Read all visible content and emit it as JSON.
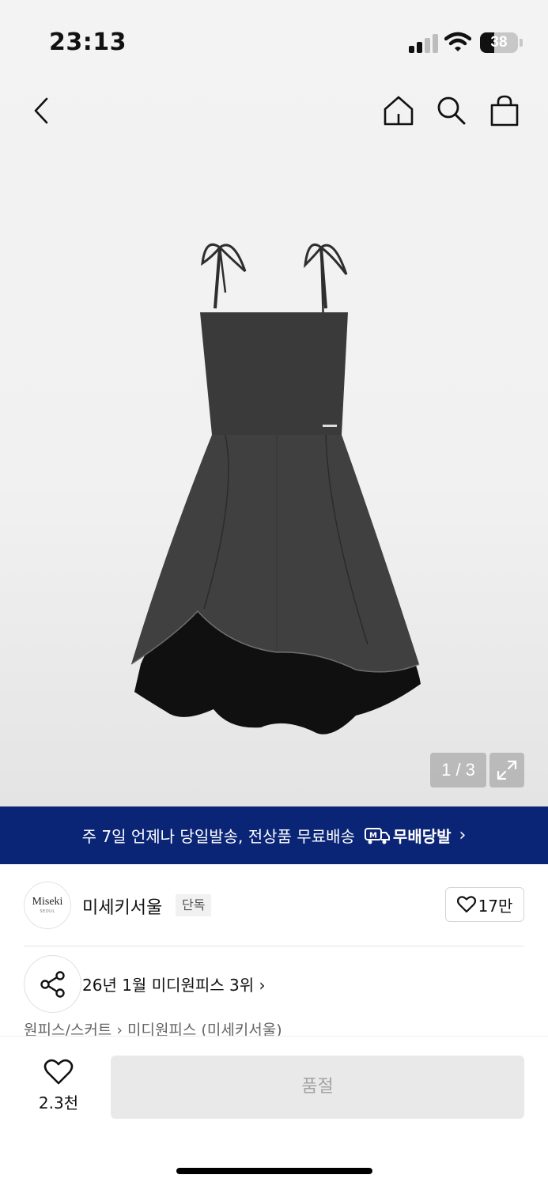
{
  "status_bar": {
    "time": "23:13",
    "battery_level": "38"
  },
  "nav": {
    "back_icon": "chevron-left-icon",
    "home_icon": "home-icon",
    "search_icon": "search-icon",
    "cart_icon": "shopping-bag-icon"
  },
  "gallery": {
    "counter": "1 / 3",
    "current_page": 1,
    "total_pages": 3,
    "image_icon": "dress-image",
    "expand_icon": "expand-icon"
  },
  "banner": {
    "text": "주 7일 언제나 당일발송, 전상품 무료배송",
    "brand": "무배당발",
    "background": "#0b2576"
  },
  "store": {
    "logo_text": "Miseki",
    "logo_subtext": "SEOUL",
    "name": "미세키서울",
    "badge": "단독",
    "like_count": "17만"
  },
  "ranking": {
    "text": "26년 1월 미디원피스 3위"
  },
  "category": {
    "parent": "원피스/스커트",
    "child": "미디원피스 (미세키서울)"
  },
  "bottom_bar": {
    "wish_count": "2.3천",
    "soldout_label": "품절"
  }
}
